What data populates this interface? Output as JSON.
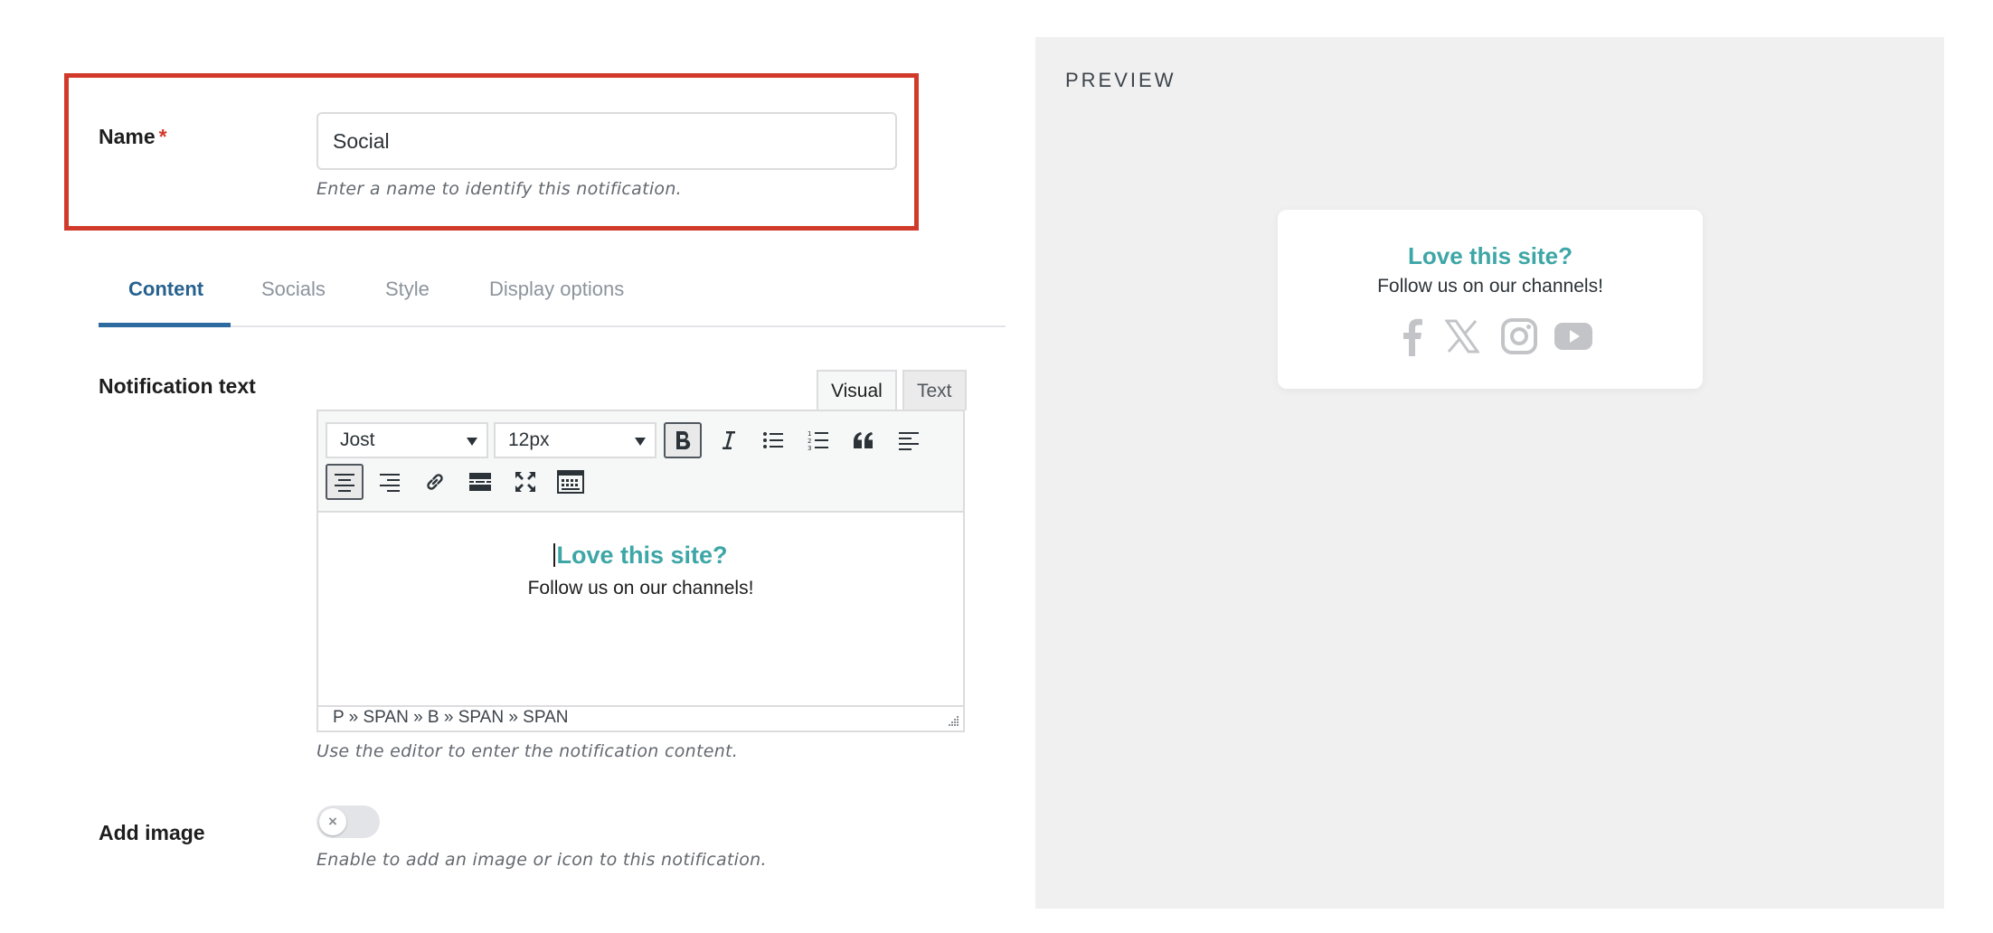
{
  "name_field": {
    "label": "Name",
    "required_marker": "*",
    "value": "Social",
    "help": "Enter a name to identify this notification."
  },
  "tabs": [
    {
      "label": "Content",
      "active": true
    },
    {
      "label": "Socials",
      "active": false
    },
    {
      "label": "Style",
      "active": false
    },
    {
      "label": "Display options",
      "active": false
    }
  ],
  "notification_text": {
    "label": "Notification text",
    "modes": {
      "visual": "Visual",
      "text": "Text",
      "active": "Visual"
    },
    "toolbar": {
      "font_family": "Jost",
      "font_size": "12px",
      "row1_buttons": [
        "bold",
        "italic",
        "bulleted-list",
        "numbered-list",
        "blockquote",
        "align-left"
      ],
      "row2_buttons": [
        "align-center",
        "align-right",
        "link",
        "read-more",
        "fullscreen",
        "toolbar-toggle"
      ],
      "pressed": [
        "bold",
        "align-center"
      ]
    },
    "content": {
      "title": "Love this site?",
      "subtitle": "Follow us on our channels!"
    },
    "status_path": "P » SPAN » B » SPAN » SPAN",
    "help": "Use the editor to enter the notification content."
  },
  "add_image": {
    "label": "Add image",
    "enabled": false,
    "toggle_glyph": "×",
    "help": "Enable to add an image or icon to this notification."
  },
  "preview": {
    "heading": "PREVIEW",
    "title": "Love this site?",
    "subtitle": "Follow us on our channels!",
    "icons": [
      "facebook-icon",
      "x-icon",
      "instagram-icon",
      "youtube-icon"
    ]
  },
  "colors": {
    "highlight_border": "#d13a2a",
    "accent_teal": "#3ea6a6",
    "active_tab": "#27628f",
    "social_icon_gray": "#c3c4c7",
    "preview_bg": "#f0f0f1"
  }
}
